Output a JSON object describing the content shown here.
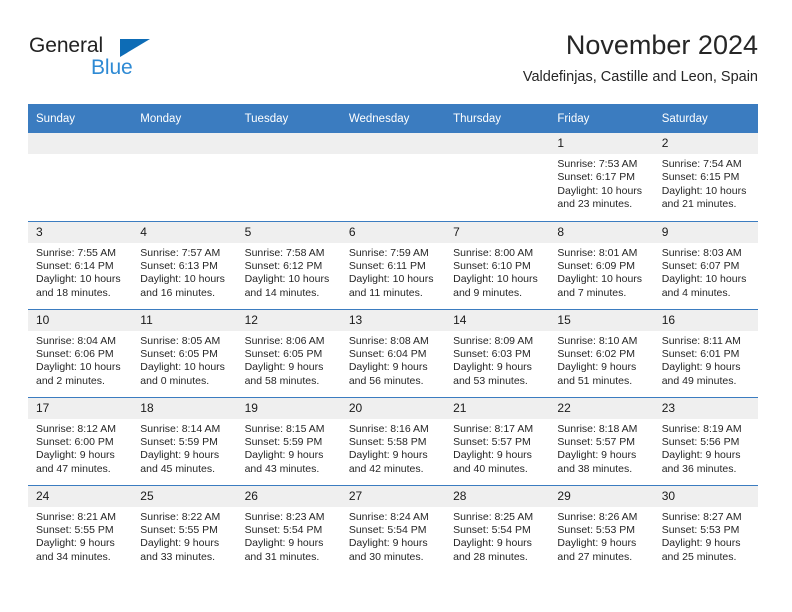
{
  "brand": {
    "name_part1": "General",
    "name_part2": "Blue",
    "accent_color": "#0d6cb6",
    "accent_color_light": "#2e8ad4",
    "triangle_icon": "triangle-icon"
  },
  "header": {
    "title": "November 2024",
    "subtitle": "Valdefinjas, Castille and Leon, Spain"
  },
  "theme": {
    "header_blue": "#3b7cc0",
    "daynum_strip": "#efefef",
    "row_divider": "#3b7cc0",
    "text": "#262626"
  },
  "calendar": {
    "weekday_headers": [
      "Sunday",
      "Monday",
      "Tuesday",
      "Wednesday",
      "Thursday",
      "Friday",
      "Saturday"
    ],
    "weeks": [
      [
        {
          "day": "",
          "sunrise": "",
          "sunset": "",
          "daylight": ""
        },
        {
          "day": "",
          "sunrise": "",
          "sunset": "",
          "daylight": ""
        },
        {
          "day": "",
          "sunrise": "",
          "sunset": "",
          "daylight": ""
        },
        {
          "day": "",
          "sunrise": "",
          "sunset": "",
          "daylight": ""
        },
        {
          "day": "",
          "sunrise": "",
          "sunset": "",
          "daylight": ""
        },
        {
          "day": "1",
          "sunrise": "Sunrise: 7:53 AM",
          "sunset": "Sunset: 6:17 PM",
          "daylight": "Daylight: 10 hours and 23 minutes."
        },
        {
          "day": "2",
          "sunrise": "Sunrise: 7:54 AM",
          "sunset": "Sunset: 6:15 PM",
          "daylight": "Daylight: 10 hours and 21 minutes."
        }
      ],
      [
        {
          "day": "3",
          "sunrise": "Sunrise: 7:55 AM",
          "sunset": "Sunset: 6:14 PM",
          "daylight": "Daylight: 10 hours and 18 minutes."
        },
        {
          "day": "4",
          "sunrise": "Sunrise: 7:57 AM",
          "sunset": "Sunset: 6:13 PM",
          "daylight": "Daylight: 10 hours and 16 minutes."
        },
        {
          "day": "5",
          "sunrise": "Sunrise: 7:58 AM",
          "sunset": "Sunset: 6:12 PM",
          "daylight": "Daylight: 10 hours and 14 minutes."
        },
        {
          "day": "6",
          "sunrise": "Sunrise: 7:59 AM",
          "sunset": "Sunset: 6:11 PM",
          "daylight": "Daylight: 10 hours and 11 minutes."
        },
        {
          "day": "7",
          "sunrise": "Sunrise: 8:00 AM",
          "sunset": "Sunset: 6:10 PM",
          "daylight": "Daylight: 10 hours and 9 minutes."
        },
        {
          "day": "8",
          "sunrise": "Sunrise: 8:01 AM",
          "sunset": "Sunset: 6:09 PM",
          "daylight": "Daylight: 10 hours and 7 minutes."
        },
        {
          "day": "9",
          "sunrise": "Sunrise: 8:03 AM",
          "sunset": "Sunset: 6:07 PM",
          "daylight": "Daylight: 10 hours and 4 minutes."
        }
      ],
      [
        {
          "day": "10",
          "sunrise": "Sunrise: 8:04 AM",
          "sunset": "Sunset: 6:06 PM",
          "daylight": "Daylight: 10 hours and 2 minutes."
        },
        {
          "day": "11",
          "sunrise": "Sunrise: 8:05 AM",
          "sunset": "Sunset: 6:05 PM",
          "daylight": "Daylight: 10 hours and 0 minutes."
        },
        {
          "day": "12",
          "sunrise": "Sunrise: 8:06 AM",
          "sunset": "Sunset: 6:05 PM",
          "daylight": "Daylight: 9 hours and 58 minutes."
        },
        {
          "day": "13",
          "sunrise": "Sunrise: 8:08 AM",
          "sunset": "Sunset: 6:04 PM",
          "daylight": "Daylight: 9 hours and 56 minutes."
        },
        {
          "day": "14",
          "sunrise": "Sunrise: 8:09 AM",
          "sunset": "Sunset: 6:03 PM",
          "daylight": "Daylight: 9 hours and 53 minutes."
        },
        {
          "day": "15",
          "sunrise": "Sunrise: 8:10 AM",
          "sunset": "Sunset: 6:02 PM",
          "daylight": "Daylight: 9 hours and 51 minutes."
        },
        {
          "day": "16",
          "sunrise": "Sunrise: 8:11 AM",
          "sunset": "Sunset: 6:01 PM",
          "daylight": "Daylight: 9 hours and 49 minutes."
        }
      ],
      [
        {
          "day": "17",
          "sunrise": "Sunrise: 8:12 AM",
          "sunset": "Sunset: 6:00 PM",
          "daylight": "Daylight: 9 hours and 47 minutes."
        },
        {
          "day": "18",
          "sunrise": "Sunrise: 8:14 AM",
          "sunset": "Sunset: 5:59 PM",
          "daylight": "Daylight: 9 hours and 45 minutes."
        },
        {
          "day": "19",
          "sunrise": "Sunrise: 8:15 AM",
          "sunset": "Sunset: 5:59 PM",
          "daylight": "Daylight: 9 hours and 43 minutes."
        },
        {
          "day": "20",
          "sunrise": "Sunrise: 8:16 AM",
          "sunset": "Sunset: 5:58 PM",
          "daylight": "Daylight: 9 hours and 42 minutes."
        },
        {
          "day": "21",
          "sunrise": "Sunrise: 8:17 AM",
          "sunset": "Sunset: 5:57 PM",
          "daylight": "Daylight: 9 hours and 40 minutes."
        },
        {
          "day": "22",
          "sunrise": "Sunrise: 8:18 AM",
          "sunset": "Sunset: 5:57 PM",
          "daylight": "Daylight: 9 hours and 38 minutes."
        },
        {
          "day": "23",
          "sunrise": "Sunrise: 8:19 AM",
          "sunset": "Sunset: 5:56 PM",
          "daylight": "Daylight: 9 hours and 36 minutes."
        }
      ],
      [
        {
          "day": "24",
          "sunrise": "Sunrise: 8:21 AM",
          "sunset": "Sunset: 5:55 PM",
          "daylight": "Daylight: 9 hours and 34 minutes."
        },
        {
          "day": "25",
          "sunrise": "Sunrise: 8:22 AM",
          "sunset": "Sunset: 5:55 PM",
          "daylight": "Daylight: 9 hours and 33 minutes."
        },
        {
          "day": "26",
          "sunrise": "Sunrise: 8:23 AM",
          "sunset": "Sunset: 5:54 PM",
          "daylight": "Daylight: 9 hours and 31 minutes."
        },
        {
          "day": "27",
          "sunrise": "Sunrise: 8:24 AM",
          "sunset": "Sunset: 5:54 PM",
          "daylight": "Daylight: 9 hours and 30 minutes."
        },
        {
          "day": "28",
          "sunrise": "Sunrise: 8:25 AM",
          "sunset": "Sunset: 5:54 PM",
          "daylight": "Daylight: 9 hours and 28 minutes."
        },
        {
          "day": "29",
          "sunrise": "Sunrise: 8:26 AM",
          "sunset": "Sunset: 5:53 PM",
          "daylight": "Daylight: 9 hours and 27 minutes."
        },
        {
          "day": "30",
          "sunrise": "Sunrise: 8:27 AM",
          "sunset": "Sunset: 5:53 PM",
          "daylight": "Daylight: 9 hours and 25 minutes."
        }
      ]
    ]
  }
}
